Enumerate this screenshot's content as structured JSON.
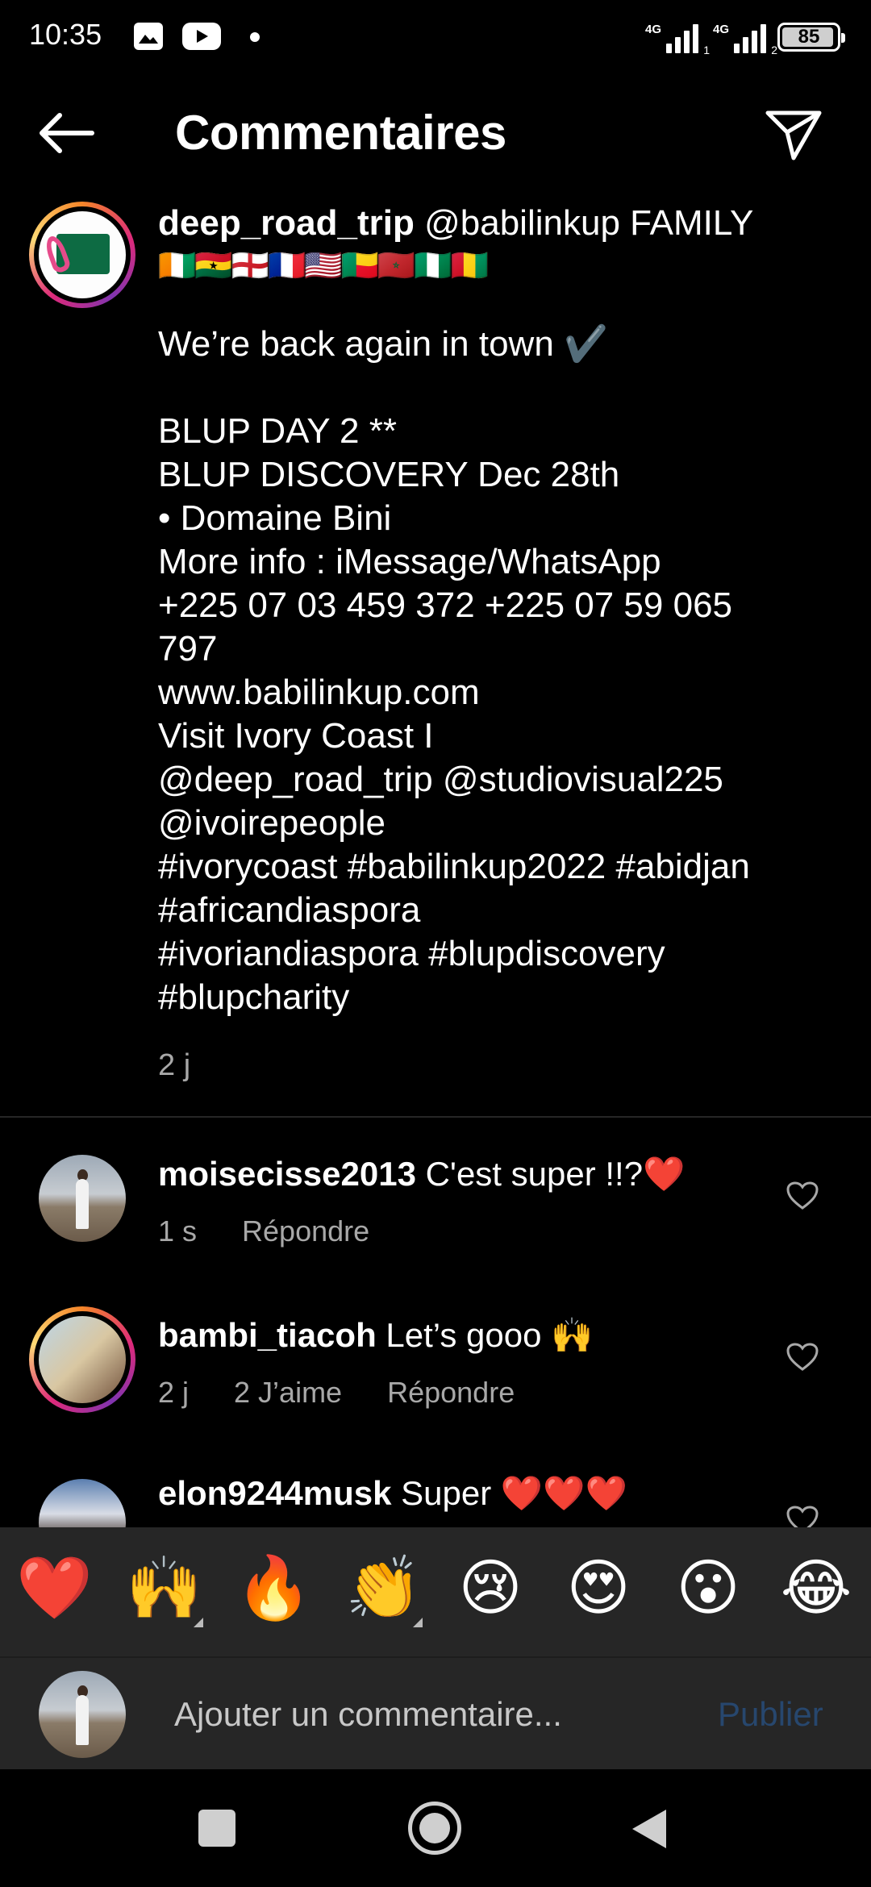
{
  "status_bar": {
    "time": "10:35",
    "network1": "4G",
    "network2": "4G",
    "sim1": "1",
    "sim2": "2",
    "battery": "85"
  },
  "header": {
    "title": "Commentaires"
  },
  "post": {
    "username": "deep_road_trip",
    "line1_rest": " @babilinkup  FAMILY",
    "flags": "🇨🇮🇬🇭🏴󠁧󠁢󠁥󠁮󠁧󠁿🇫🇷🇺🇸🇧🇯🇲🇦🇳🇬🇬🇳",
    "caption_lines": [
      "We’re back again in town ✔️",
      "",
      "BLUP DAY 2 **",
      "BLUP DISCOVERY Dec 28th",
      "• Domaine Bini",
      "More info : iMessage/WhatsApp",
      "+225 07 03 459 372 +225 07 59 065",
      "797",
      "www.babilinkup.com",
      "Visit Ivory Coast I",
      "@deep_road_trip @studiovisual225",
      "@ivoirepeople",
      "#ivorycoast #babilinkup2022 #abidjan",
      "#africandiaspora",
      "#ivoriandiaspora #blupdiscovery",
      "#blupcharity"
    ],
    "time": "2 j"
  },
  "comments": [
    {
      "username": "moisecisse2013",
      "text": " C'est super !!?❤️",
      "time": "1 s",
      "likes": "",
      "reply": "Répondre"
    },
    {
      "username": "bambi_tiacoh",
      "text": " Let’s gooo 🙌",
      "time": "2 j",
      "likes": "2 J’aime",
      "reply": "Répondre"
    },
    {
      "username": "elon9244musk",
      "text": " Super ❤️❤️❤️",
      "time": "",
      "likes": "",
      "reply": ""
    }
  ],
  "emoji_bar": [
    "❤️",
    "🙌",
    "🔥",
    "👏",
    "😢",
    "😍",
    "😮",
    "😂"
  ],
  "composer": {
    "placeholder": "Ajouter un commentaire...",
    "publish": "Publier"
  },
  "colors": {
    "background": "#000000",
    "panel": "#262626",
    "muted_text": "#a8a8a8",
    "publish_disabled": "#27476e"
  }
}
